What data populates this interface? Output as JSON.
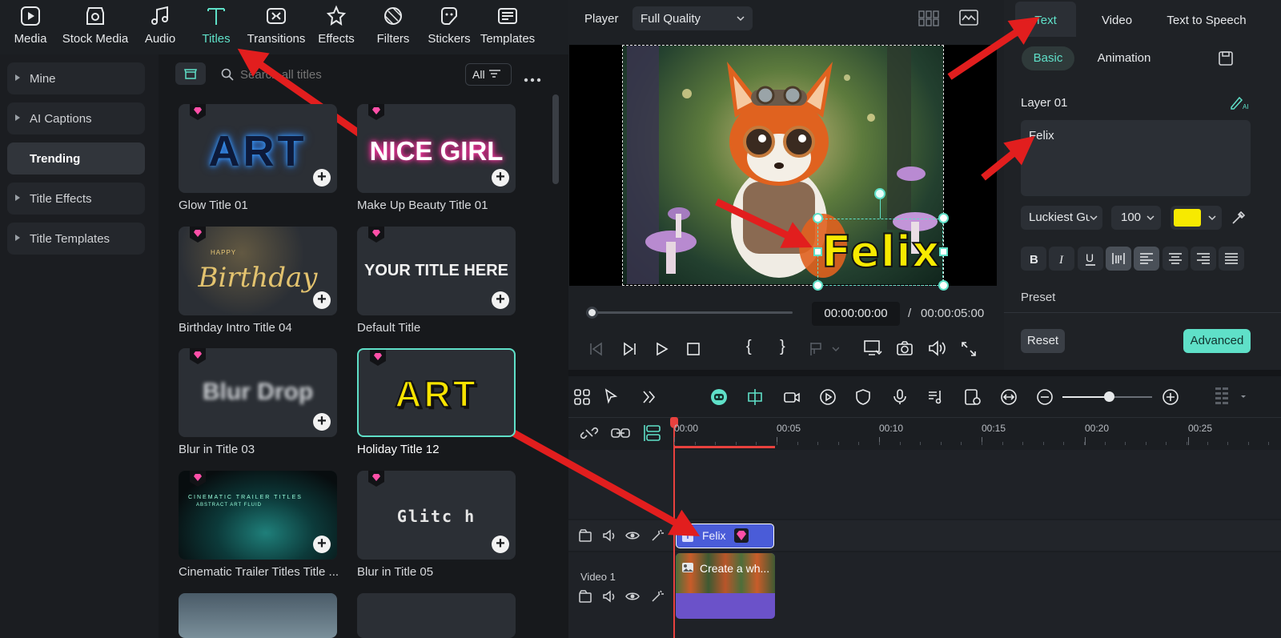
{
  "nav": {
    "tabs": [
      {
        "label": "Media",
        "icon": "media-icon"
      },
      {
        "label": "Stock Media",
        "icon": "stock-media-icon"
      },
      {
        "label": "Audio",
        "icon": "music-note-icon"
      },
      {
        "label": "Titles",
        "icon": "text-t-icon",
        "active": true
      },
      {
        "label": "Transitions",
        "icon": "transitions-icon"
      },
      {
        "label": "Effects",
        "icon": "effects-star-icon"
      },
      {
        "label": "Filters",
        "icon": "filters-icon"
      },
      {
        "label": "Stickers",
        "icon": "sticker-icon"
      },
      {
        "label": "Templates",
        "icon": "templates-icon"
      }
    ]
  },
  "sidebar": {
    "items": [
      {
        "label": "Mine"
      },
      {
        "label": "AI Captions"
      },
      {
        "label": "Trending",
        "active": true
      },
      {
        "label": "Title Effects"
      },
      {
        "label": "Title Templates"
      }
    ]
  },
  "search": {
    "placeholder": "Search all titles",
    "filter_label": "All"
  },
  "titles": [
    {
      "name": "Glow Title 01",
      "preview": "ART"
    },
    {
      "name": "Make Up Beauty Title 01",
      "preview": "NICE GIRL"
    },
    {
      "name": "Birthday Intro Title 04",
      "preview": "Birthday",
      "pre_small": "HAPPY"
    },
    {
      "name": "Default Title",
      "preview": "YOUR TITLE HERE"
    },
    {
      "name": "Blur in Title 03",
      "preview": "Blur Drop"
    },
    {
      "name": "Holiday Title 12",
      "preview": "ART"
    },
    {
      "name": "Cinematic Trailer Titles Title ...",
      "preview": "CINEMATIC TRAILER TITLES",
      "pre_small": "ABSTRACT ART FLUID"
    },
    {
      "name": "Blur in Title 05",
      "preview": "Glitc h"
    }
  ],
  "player": {
    "label": "Player",
    "quality": "Full Quality",
    "overlay_text": "Felix",
    "current_time": "00:00:00:00",
    "separator": "/",
    "total_time": "00:00:05:00"
  },
  "text_panel": {
    "tabs": [
      "Text",
      "Video",
      "Text to Speech"
    ],
    "subtabs": [
      "Basic",
      "Animation"
    ],
    "layer_label": "Layer 01",
    "text_value": "Felix",
    "font": "Luckiest Gu",
    "size": "100",
    "color": "#f7ea00",
    "preset_label": "Preset",
    "reset_label": "Reset",
    "advanced_label": "Advanced"
  },
  "timeline": {
    "ruler": [
      "00:00",
      "00:05",
      "00:10",
      "00:15",
      "00:20",
      "00:25"
    ],
    "title_clip": "Felix",
    "video_clip": "Create a wh...",
    "track_label": "Video 1"
  },
  "colors": {
    "accent": "#5fe0c8",
    "arrow": "#e21e1e",
    "clip_title": "#4a5cd8",
    "clip_video": "#6b52c9",
    "playhead": "#e8413e"
  }
}
